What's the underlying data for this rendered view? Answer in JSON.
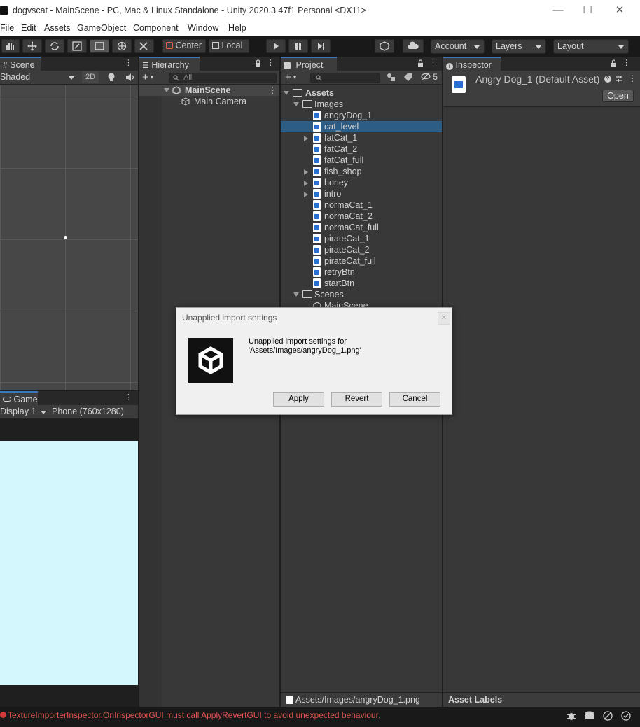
{
  "window": {
    "title": "dogvscat - MainScene - PC, Mac & Linux Standalone - Unity 2020.3.47f1 Personal <DX11>",
    "minimize": "—",
    "maximize": "☐",
    "close": "✕"
  },
  "menu": [
    "File",
    "Edit",
    "Assets",
    "GameObject",
    "Component",
    "Window",
    "Help"
  ],
  "toolbar": {
    "pivot": "Center",
    "space": "Local",
    "account": "Account",
    "layers": "Layers",
    "layout": "Layout"
  },
  "scene": {
    "tab": "Scene",
    "draw_mode": "Shaded",
    "toggle_2d": "2D"
  },
  "game": {
    "tab": "Game",
    "display": "Display 1",
    "resolution": "Phone (760x1280)",
    "bg_color": "#d4f6fd"
  },
  "hierarchy": {
    "tab": "Hierarchy",
    "search_placeholder": "All",
    "scene_name": "MainScene",
    "items": [
      "Main Camera"
    ]
  },
  "project": {
    "tab": "Project",
    "hidden_count": "5",
    "root": "Assets",
    "images_folder": "Images",
    "files": [
      {
        "name": "angryDog_1",
        "expandable": false,
        "icon": "image-icon"
      },
      {
        "name": "cat_level",
        "expandable": false,
        "icon": "image-icon",
        "selected": true
      },
      {
        "name": "fatCat_1",
        "expandable": true,
        "icon": "sprite-sheet-icon"
      },
      {
        "name": "fatCat_2",
        "expandable": false,
        "icon": "image-icon"
      },
      {
        "name": "fatCat_full",
        "expandable": false,
        "icon": "image-icon"
      },
      {
        "name": "fish_shop",
        "expandable": true,
        "icon": "sprite-sheet-icon"
      },
      {
        "name": "honey",
        "expandable": true,
        "icon": "sprite-sheet-icon"
      },
      {
        "name": "intro",
        "expandable": true,
        "icon": "sprite-sheet-icon"
      },
      {
        "name": "normaCat_1",
        "expandable": false,
        "icon": "image-icon"
      },
      {
        "name": "normaCat_2",
        "expandable": false,
        "icon": "image-icon"
      },
      {
        "name": "normaCat_full",
        "expandable": false,
        "icon": "image-icon"
      },
      {
        "name": "pirateCat_1",
        "expandable": false,
        "icon": "image-icon"
      },
      {
        "name": "pirateCat_2",
        "expandable": false,
        "icon": "image-icon"
      },
      {
        "name": "pirateCat_full",
        "expandable": false,
        "icon": "image-icon"
      },
      {
        "name": "retryBtn",
        "expandable": false,
        "icon": "image-icon"
      },
      {
        "name": "startBtn",
        "expandable": false,
        "icon": "image-icon"
      }
    ],
    "scenes_folder": "Scenes",
    "scene_file": "MainScene",
    "footer_path": "Assets/Images/angryDog_1.png"
  },
  "inspector": {
    "tab": "Inspector",
    "asset_title": "Angry Dog_1 (Default Asset)",
    "open_button": "Open",
    "asset_labels": "Asset Labels"
  },
  "dialog": {
    "title": "Unapplied import settings",
    "close": "✕",
    "message_line1": "Unapplied import settings for",
    "message_line2": "'Assets/Images/angryDog_1.png'",
    "apply": "Apply",
    "revert": "Revert",
    "cancel": "Cancel"
  },
  "status": {
    "error": "TextureImporterInspector.OnInspectorGUI must call ApplyRevertGUI to avoid unexpected behaviour."
  }
}
